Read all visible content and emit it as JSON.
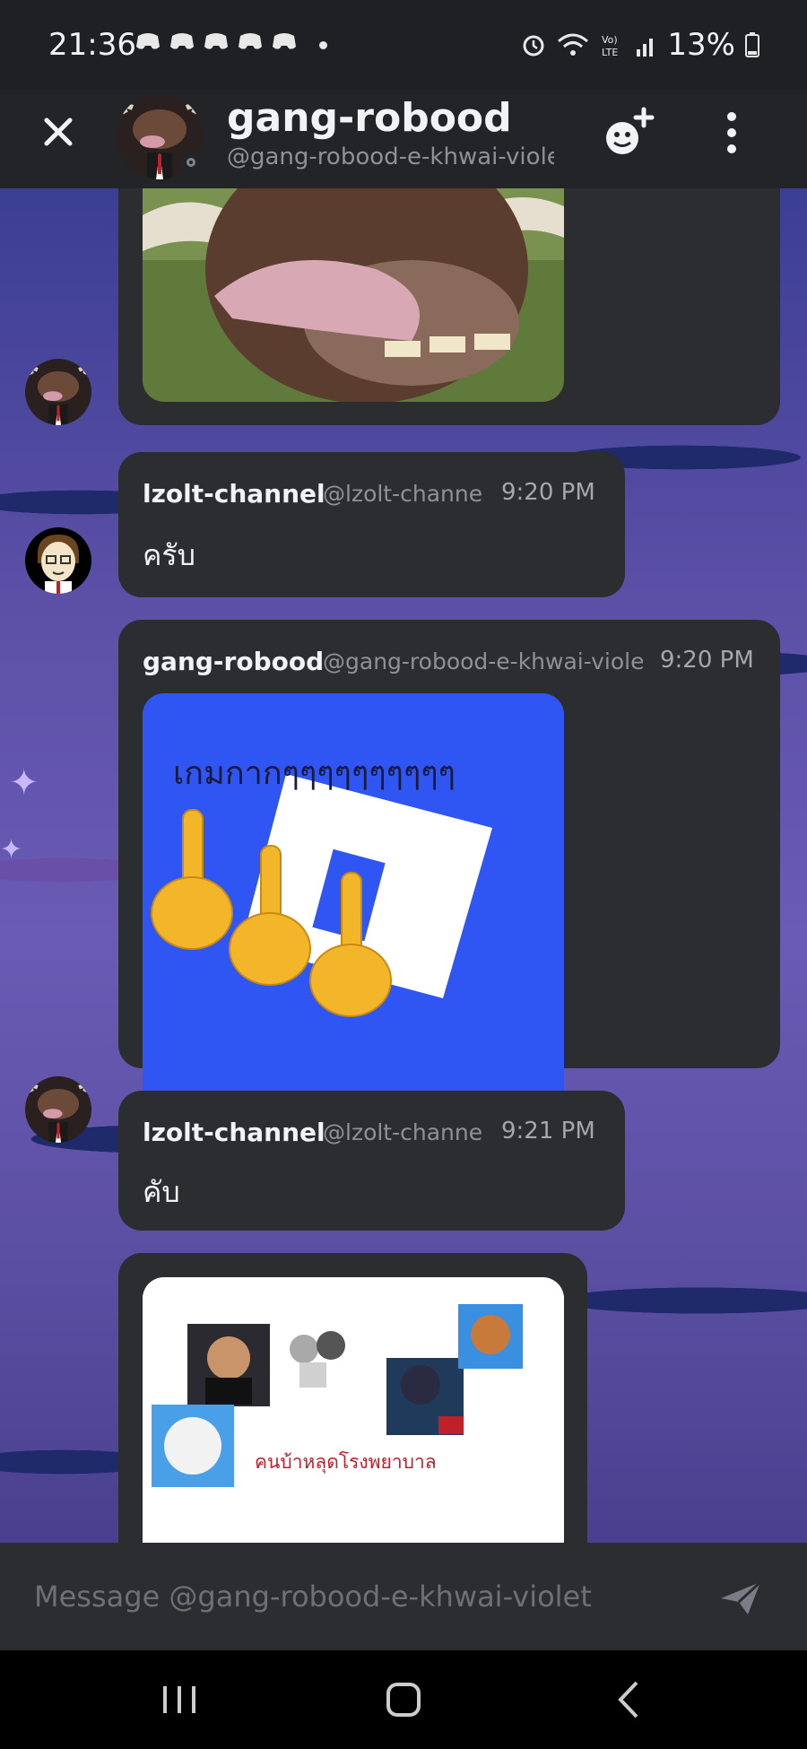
{
  "status_bar": {
    "time": "21:36",
    "battery": "13%"
  },
  "header": {
    "title": "gang-robood",
    "subtitle": "@gang-robood-e-khwai-violet"
  },
  "messages": [
    {
      "author": "lzolt-channel",
      "handle": "@lzolt-channel",
      "time": "9:20 PM",
      "text": "ครับ"
    },
    {
      "author": "gang-robood",
      "handle": "@gang-robood-e-khwai-violet",
      "time": "9:20 PM",
      "image_text": "เกมกากๆๆๆๆๆๆๆๆๆๆ"
    },
    {
      "author": "lzolt-channel",
      "handle": "@lzolt-channel",
      "time": "9:21 PM",
      "text": "คับ"
    },
    {
      "image_caption": "คนบ้าหลุดโรงพยาบาล"
    }
  ],
  "composer": {
    "placeholder": "Message @gang-robood-e-khwai-violet"
  },
  "colors": {
    "background": "#1e1f22",
    "card": "#2b2d31",
    "accent_blue": "#2f56f3"
  }
}
